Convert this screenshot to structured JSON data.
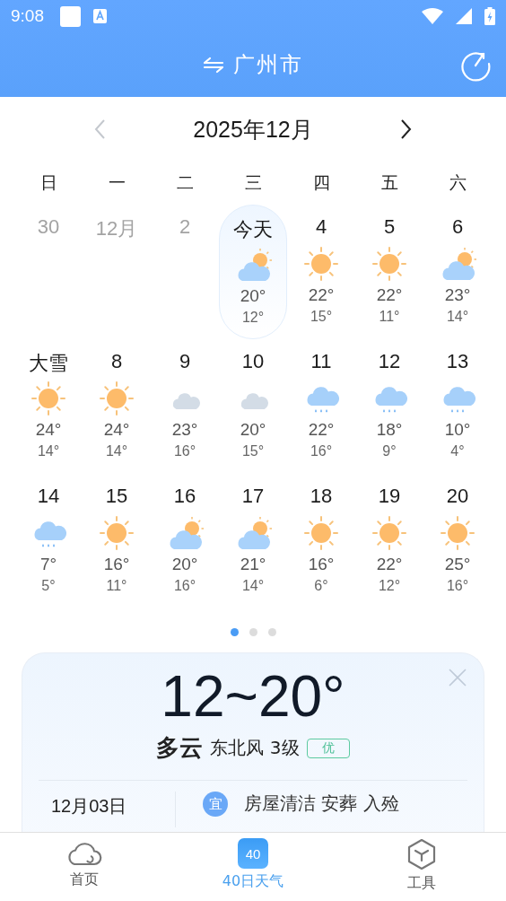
{
  "status_bar": {
    "time": "9:08"
  },
  "header": {
    "city": "广州市"
  },
  "calendar": {
    "title": "2025年12月",
    "weekdays": [
      "日",
      "一",
      "二",
      "三",
      "四",
      "五",
      "六"
    ],
    "days": [
      {
        "label": "30",
        "past": true,
        "selected": false
      },
      {
        "label": "12月",
        "past": true,
        "selected": false
      },
      {
        "label": "2",
        "past": true,
        "selected": false
      },
      {
        "label": "今天",
        "past": false,
        "selected": true,
        "kind": "partly",
        "high": "20°",
        "low": "12°"
      },
      {
        "label": "4",
        "past": false,
        "selected": false,
        "kind": "sun",
        "high": "22°",
        "low": "15°"
      },
      {
        "label": "5",
        "past": false,
        "selected": false,
        "kind": "sun",
        "high": "22°",
        "low": "11°"
      },
      {
        "label": "6",
        "past": false,
        "selected": false,
        "kind": "partly",
        "high": "23°",
        "low": "14°"
      },
      {
        "label": "大雪",
        "past": false,
        "selected": false,
        "kind": "sun",
        "high": "24°",
        "low": "14°"
      },
      {
        "label": "8",
        "past": false,
        "selected": false,
        "kind": "sun",
        "high": "24°",
        "low": "14°"
      },
      {
        "label": "9",
        "past": false,
        "selected": false,
        "kind": "cloud",
        "high": "23°",
        "low": "16°"
      },
      {
        "label": "10",
        "past": false,
        "selected": false,
        "kind": "cloud",
        "high": "20°",
        "low": "15°"
      },
      {
        "label": "11",
        "past": false,
        "selected": false,
        "kind": "rain",
        "high": "22°",
        "low": "16°"
      },
      {
        "label": "12",
        "past": false,
        "selected": false,
        "kind": "rain",
        "high": "18°",
        "low": "9°"
      },
      {
        "label": "13",
        "past": false,
        "selected": false,
        "kind": "rain",
        "high": "10°",
        "low": "4°"
      },
      {
        "label": "14",
        "past": false,
        "selected": false,
        "kind": "rain",
        "high": "7°",
        "low": "5°"
      },
      {
        "label": "15",
        "past": false,
        "selected": false,
        "kind": "sun",
        "high": "16°",
        "low": "11°"
      },
      {
        "label": "16",
        "past": false,
        "selected": false,
        "kind": "partly",
        "high": "20°",
        "low": "16°"
      },
      {
        "label": "17",
        "past": false,
        "selected": false,
        "kind": "partly",
        "high": "21°",
        "low": "14°"
      },
      {
        "label": "18",
        "past": false,
        "selected": false,
        "kind": "sun",
        "high": "16°",
        "low": "6°"
      },
      {
        "label": "19",
        "past": false,
        "selected": false,
        "kind": "sun",
        "high": "22°",
        "low": "12°"
      },
      {
        "label": "20",
        "past": false,
        "selected": false,
        "kind": "sun",
        "high": "25°",
        "low": "16°"
      }
    ]
  },
  "pager": [
    {
      "selected": true
    },
    {
      "selected": false
    },
    {
      "selected": false
    }
  ],
  "detail": {
    "temp_range": "12~20°",
    "condition": "多云",
    "wind": "东北风 3级",
    "aqi": "优",
    "date": "12月03日",
    "suitable_badge": "宜",
    "suitable": "房屋清洁 安葬 入殓"
  },
  "tabs": [
    {
      "label": "首页",
      "kind": "cloud",
      "selected": false
    },
    {
      "label": "40日天气",
      "kind": "calendar",
      "badge": "40",
      "selected": true
    },
    {
      "label": "工具",
      "kind": "hexagon",
      "selected": false
    }
  ]
}
